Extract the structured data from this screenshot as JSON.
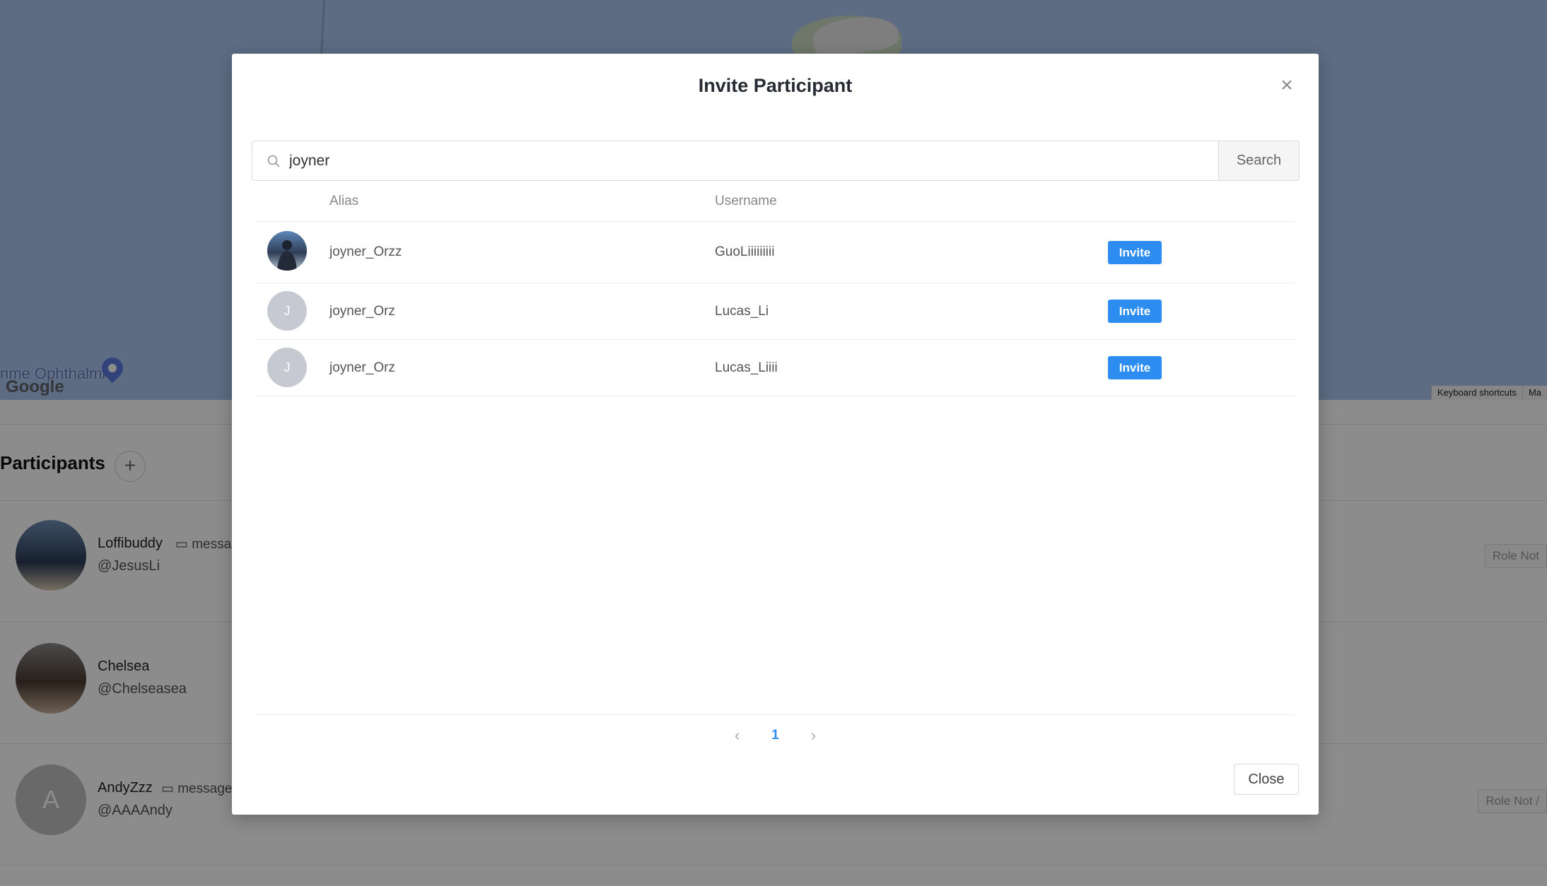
{
  "background": {
    "map": {
      "place_label": "nme Ophthalmic",
      "logo_text": "Google",
      "footer": [
        "Keyboard shortcuts",
        "Ma"
      ]
    },
    "participants": {
      "title": "Participants",
      "add_label": "+",
      "items": [
        {
          "name": "Loffibuddy",
          "handle": "@JesusLi",
          "message": "messag",
          "role": "Role Not",
          "initial": ""
        },
        {
          "name": "Chelsea",
          "handle": "@Chelseasea",
          "message": "",
          "role": "",
          "initial": ""
        },
        {
          "name": "AndyZzz",
          "handle": "@AAAAndy",
          "message": "message",
          "role": "Role Not /",
          "initial": "A"
        }
      ]
    }
  },
  "modal": {
    "title": "Invite Participant",
    "close_icon": "×",
    "search": {
      "value": "joyner",
      "placeholder": "",
      "button_label": "Search"
    },
    "table": {
      "columns": [
        "",
        "Alias",
        "Username",
        ""
      ],
      "rows": [
        {
          "avatar_initial": "",
          "alias": "joyner_Orzz",
          "username": "GuoLiiiiiiiii",
          "action": "Invite"
        },
        {
          "avatar_initial": "J",
          "alias": "joyner_Orz",
          "username": "Lucas_Li",
          "action": "Invite"
        },
        {
          "avatar_initial": "J",
          "alias": "joyner_Orz",
          "username": "Lucas_Liiii",
          "action": "Invite"
        }
      ]
    },
    "pagination": {
      "prev": "‹",
      "current": "1",
      "next": "›"
    },
    "close_button": "Close"
  },
  "colors": {
    "primary": "#2d8cf0",
    "overlay": "rgba(0,0,0,0.45)",
    "map_water": "#aac5ee"
  }
}
